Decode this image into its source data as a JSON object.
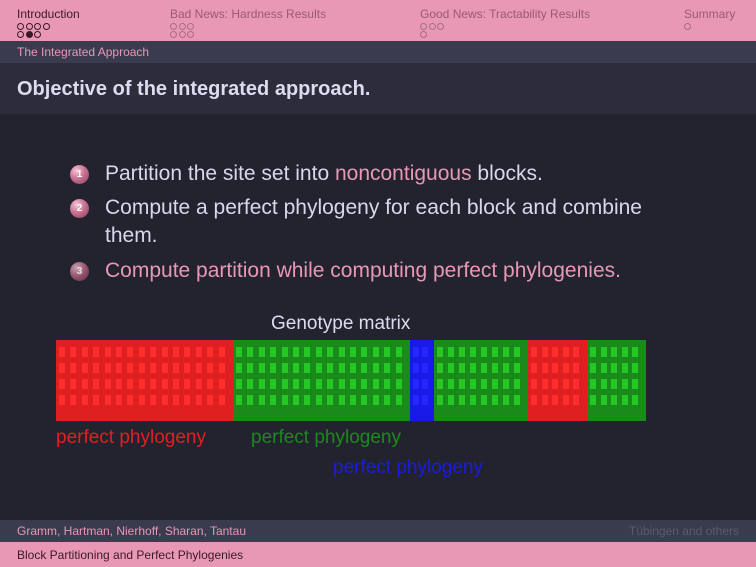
{
  "nav": {
    "sections": [
      {
        "label": "Introduction",
        "active": true,
        "rows": [
          [
            0,
            0,
            0,
            0
          ],
          [
            0,
            1,
            0
          ]
        ]
      },
      {
        "label": "Bad News: Hardness Results",
        "active": false,
        "rows": [
          [
            0,
            0,
            0
          ],
          [
            0,
            0,
            0
          ]
        ]
      },
      {
        "label": "Good News: Tractability Results",
        "active": false,
        "rows": [
          [
            0,
            0,
            0
          ],
          [
            0
          ]
        ]
      },
      {
        "label": "Summary",
        "active": false,
        "rows": [
          [
            0
          ]
        ]
      }
    ]
  },
  "subsection": "The Integrated Approach",
  "frame_title": "Objective of the integrated approach.",
  "items": [
    {
      "number": "1",
      "before": "Partition the site set into ",
      "highlight": "noncontiguous",
      "after": " blocks."
    },
    {
      "number": "2",
      "line1": "Compute a perfect phylogeny for each block and combine",
      "line2": "them."
    },
    {
      "number": "3",
      "text": "Compute partition while computing perfect phylogenies."
    }
  ],
  "matrix": {
    "title": "Genotype matrix",
    "rows": 4,
    "colors": {
      "red": "#e02020",
      "green": "#1a8a1a",
      "blue": "#1a1ae8"
    },
    "blocks": [
      {
        "color": "red",
        "columns": 15
      },
      {
        "color": "green",
        "columns": 15
      },
      {
        "color": "blue",
        "columns": 2
      },
      {
        "color": "green",
        "columns": 8
      },
      {
        "color": "red",
        "columns": 5
      },
      {
        "color": "green",
        "columns": 5
      }
    ]
  },
  "labels": [
    {
      "text": "perfect phylogeny",
      "color": "#e02020"
    },
    {
      "text": "perfect phylogeny",
      "color": "#1a8a1a"
    },
    {
      "text": "perfect phylogeny",
      "color": "#1a1ae8"
    }
  ],
  "footer": {
    "authors": "Gramm, Hartman, Nierhoff, Sharan, Tantau",
    "institute": "Tübingen and others",
    "talk_title": "Block Partitioning and Perfect Phylogenies"
  }
}
